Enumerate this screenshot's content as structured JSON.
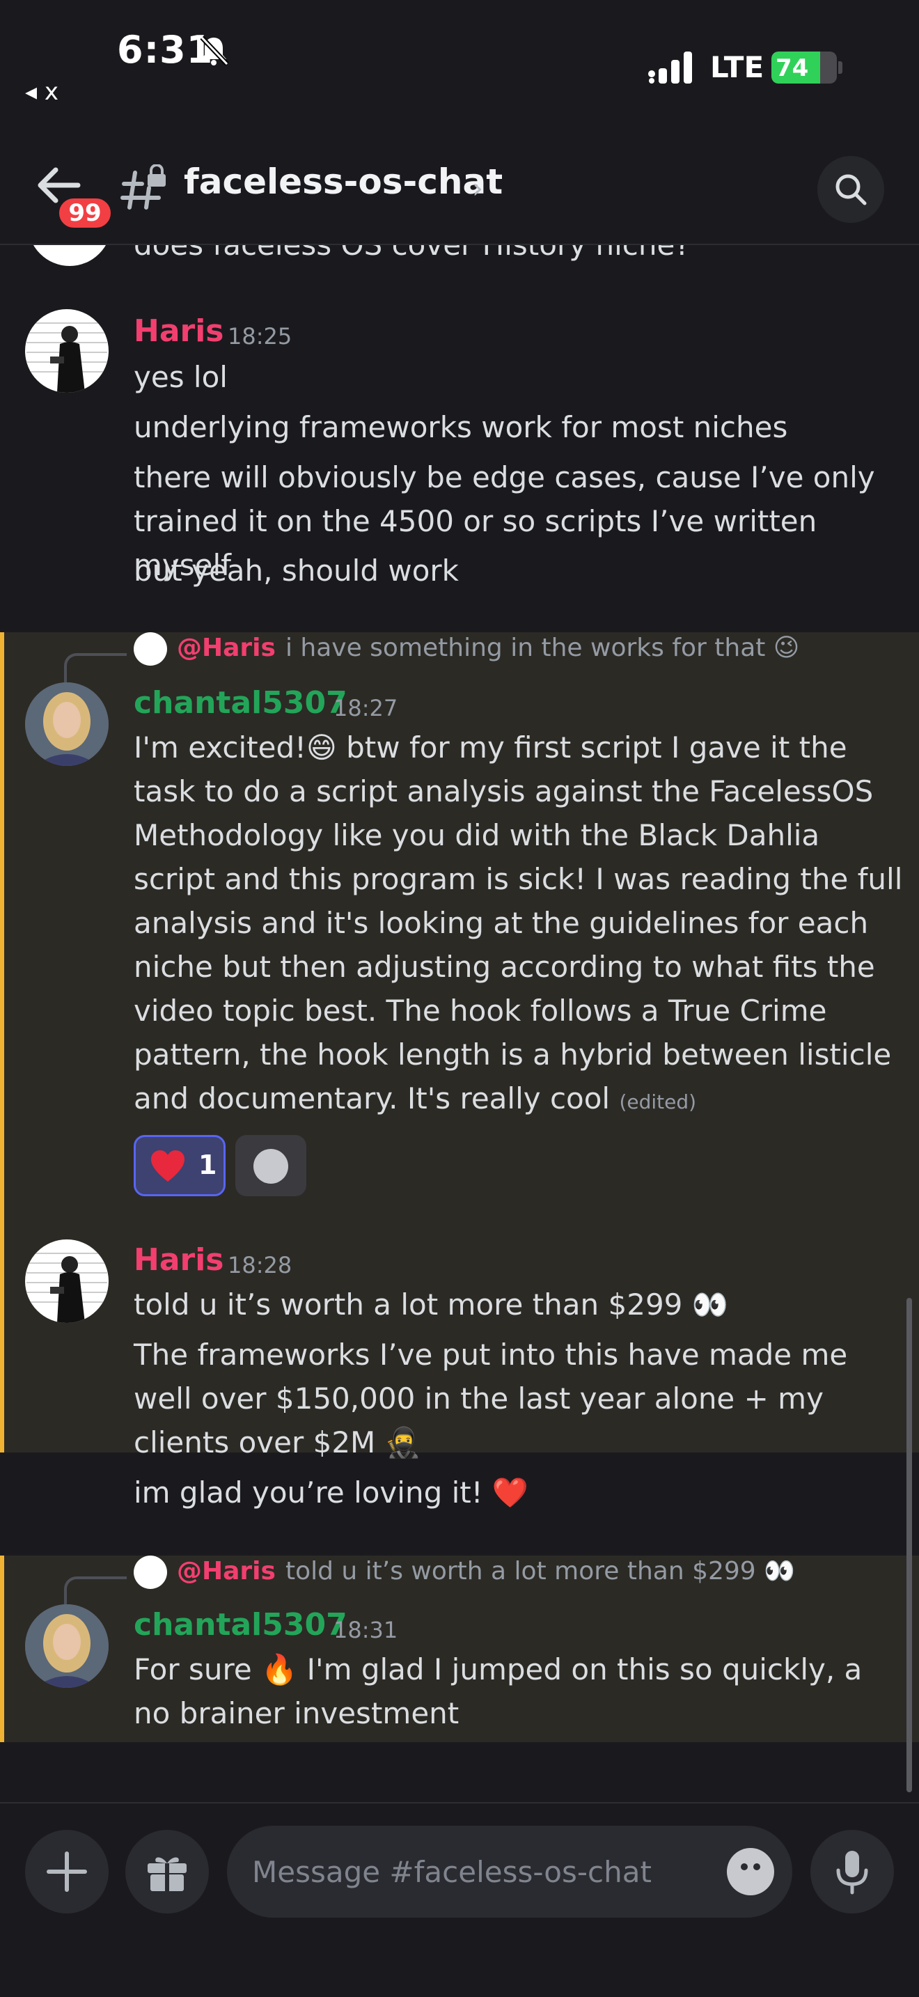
{
  "status_bar": {
    "time": "6:31",
    "back_label": "◂ x",
    "network": "LTE",
    "battery": "74",
    "battery_level": 0.74
  },
  "header": {
    "back_badge": "99",
    "channel_name": "faceless-os-chat",
    "chevron": "›"
  },
  "messages": [
    {
      "cut_text": "does faceless OS cover History niche?"
    },
    {
      "author": "Haris",
      "time": "18:25",
      "lines": [
        "yes lol",
        "underlying frameworks work for most niches",
        "there will obviously be edge cases, cause I’ve only trained it on the 4500 or so scripts I’ve written myself",
        "but yeah, should work"
      ]
    },
    {
      "reply_mention": "@Haris",
      "reply_text": "i have something in the works for that 😉",
      "author": "chantal5307",
      "time": "18:27",
      "text": "I'm excited!😄  btw for my first script I gave it the task to do a script analysis against the FacelessOS Methodology like you did with the Black Dahlia script and this program is sick! I was reading the full analysis and it's looking at the guidelines for each niche but then adjusting according to what fits the video topic best. The hook follows a True Crime pattern, the hook length is a hybrid between listicle and documentary. It's really cool",
      "edited": "(edited)",
      "reaction_count": "1"
    },
    {
      "author": "Haris",
      "time": "18:28",
      "lines": [
        "told u it’s worth a lot more than $299 👀",
        "The frameworks I’ve put into this have made me well over $150,000 in the last year alone + my clients over $2M 🥷",
        "im glad you’re loving it! ❤️"
      ]
    },
    {
      "reply_mention": "@Haris",
      "reply_text": "told u it’s worth a lot more than $299 👀",
      "author": "chantal5307",
      "time": "18:31",
      "text": "For sure 🔥  I'm glad I jumped on this so quickly, a no brainer investment"
    }
  ],
  "composer": {
    "placeholder": "Message #faceless-os-chat"
  },
  "colors": {
    "haris": "#f23f6f",
    "chantal": "#23a559",
    "highlight_bar": "#f0b232",
    "highlight_bg": "#2c2a25",
    "background": "#1a1a1e"
  },
  "icons": [
    "bell-slash-icon",
    "signal-icon",
    "battery-icon",
    "arrow-left-icon",
    "channel-hash-lock-icon",
    "search-icon",
    "heart-emoji-icon",
    "add-reaction-icon",
    "plus-icon",
    "gift-icon",
    "emoji-icon",
    "microphone-icon"
  ]
}
